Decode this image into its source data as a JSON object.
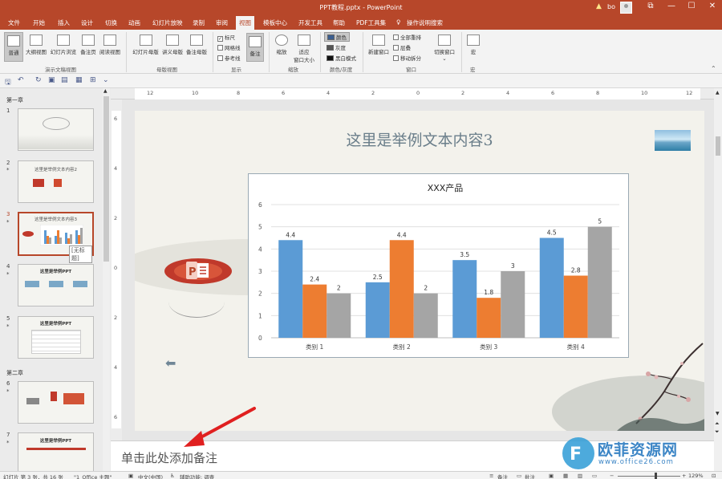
{
  "app": {
    "window_title": "PPT教程.pptx  -  PowerPoint",
    "user": "bo",
    "controls": {
      "restore": "⧉",
      "minimize": "—",
      "maximize": "☐",
      "close": "✕"
    }
  },
  "tabs": [
    "文件",
    "开始",
    "插入",
    "设计",
    "切换",
    "动画",
    "幻灯片放映",
    "录制",
    "审阅",
    "视图",
    "模板中心",
    "开发工具",
    "帮助",
    "PDF工具集",
    "操作说明搜索"
  ],
  "active_tab": "视图",
  "ribbon": {
    "views": {
      "normal": "普通",
      "outline": "大纲视图",
      "sorter": "幻灯片浏览",
      "notes": "备注页",
      "reading": "阅读视图",
      "group": "演示文稿视图"
    },
    "masters": {
      "slide_master": "幻灯片母版",
      "handout_master": "讲义母版",
      "notes_master": "备注母版",
      "group": "母版视图"
    },
    "show": {
      "ruler": "标尺",
      "gridlines": "网格线",
      "guides": "参考线",
      "notes": "备注",
      "group": "显示"
    },
    "zoom": {
      "zoom": "缩放",
      "fit": "适应",
      "fit2": "窗口大小",
      "group": "缩放"
    },
    "color": {
      "color": "颜色",
      "grayscale": "灰度",
      "bw": "黑白模式",
      "group": "颜色/灰度"
    },
    "window": {
      "new_window": "新建窗口",
      "arrange_all": "全部重排",
      "cascade": "层叠",
      "move_split": "移动拆分",
      "switch": "切换窗口",
      "group": "窗口"
    },
    "macro": {
      "macro": "宏",
      "group": "宏"
    }
  },
  "thumbnails": {
    "sections": [
      "第一章",
      "第二章"
    ],
    "tooltip": "[无标题]",
    "slides": [
      {
        "num": "1",
        "title": ""
      },
      {
        "num": "2",
        "title": "这里是举例文本内容2"
      },
      {
        "num": "3",
        "title": "这里是举例文本内容3"
      },
      {
        "num": "4",
        "title": "这里是举例PPT"
      },
      {
        "num": "5",
        "title": "这里是举例PPT"
      },
      {
        "num": "6",
        "title": ""
      },
      {
        "num": "7",
        "title": "这里是举例PPT"
      }
    ]
  },
  "rulers": {
    "h": [
      "12",
      "10",
      "8",
      "6",
      "4",
      "2",
      "0",
      "2",
      "4",
      "6",
      "8",
      "10",
      "12"
    ],
    "v": [
      "6",
      "4",
      "2",
      "0",
      "2",
      "4",
      "6"
    ]
  },
  "slide": {
    "title": "这里是举例文本内容3"
  },
  "chart_data": {
    "type": "bar",
    "title": "XXX产品",
    "categories": [
      "类别 1",
      "类别 2",
      "类别 3",
      "类别 4"
    ],
    "series": [
      {
        "values": [
          4.4,
          2.5,
          3.5,
          4.5
        ],
        "color": "#5b9bd5"
      },
      {
        "values": [
          2.4,
          4.4,
          1.8,
          2.8
        ],
        "color": "#ed7d31"
      },
      {
        "values": [
          2,
          2,
          3,
          5
        ],
        "color": "#a5a5a5"
      }
    ],
    "y_ticks": [
      "0",
      "1",
      "2",
      "3",
      "4",
      "5",
      "6"
    ],
    "ylim": [
      0,
      6
    ],
    "grid": true,
    "legend": "none"
  },
  "notes": {
    "placeholder": "单击此处添加备注"
  },
  "status": {
    "slide_info": "幻灯片 第 3 张，共 16 张",
    "theme": "\"1_Office 主题\"",
    "language": "中文(中国)",
    "accessibility": "辅助功能: 调查",
    "notes": "备注",
    "comments": "批注",
    "zoom": "129%"
  },
  "watermark": {
    "text": "欧菲资源网",
    "url": "www.office26.com"
  }
}
